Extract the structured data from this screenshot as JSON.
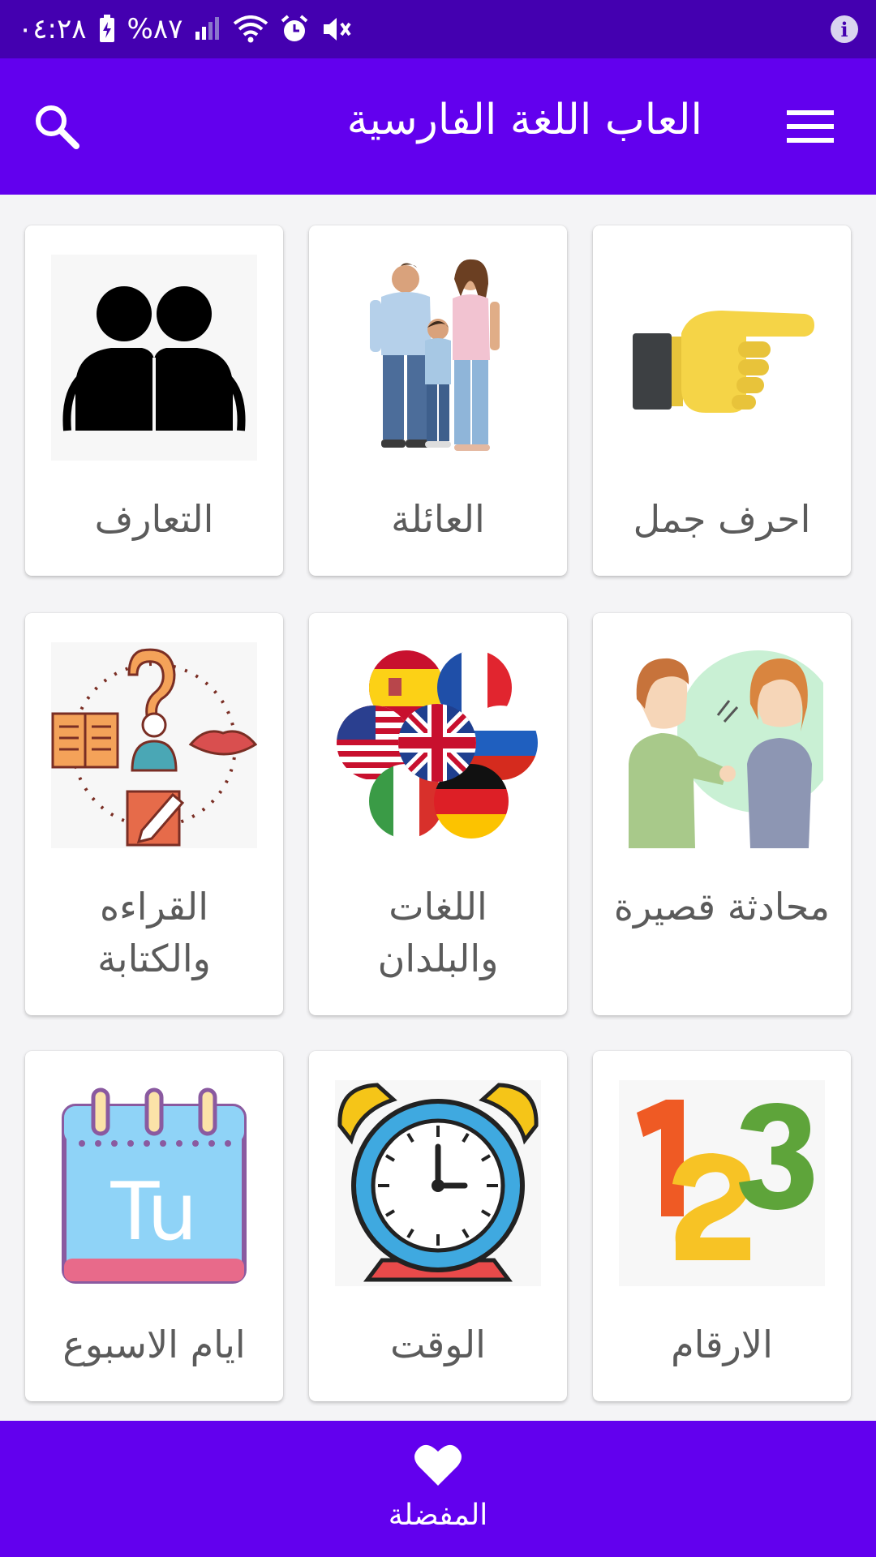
{
  "status_bar": {
    "time": "٠٤:٢٨",
    "battery": "%٨٧",
    "icons": [
      "battery-charging-icon",
      "signal-icon",
      "wifi-icon",
      "alarm-icon",
      "mute-icon",
      "info-icon"
    ]
  },
  "app_bar": {
    "title": "العاب اللغة الفارسية",
    "background": "#6200ee",
    "icons": [
      "search-icon",
      "menu-icon"
    ]
  },
  "categories": [
    {
      "label": "احرف جمل",
      "icon": "pointing-hand-icon"
    },
    {
      "label": "العائلة",
      "icon": "family-photo"
    },
    {
      "label": "التعارف",
      "icon": "two-people-icon"
    },
    {
      "label": "محادثة قصيرة",
      "icon": "conversation-icon"
    },
    {
      "label": "اللغات والبلدان",
      "icon": "flags-icon"
    },
    {
      "label": "القراءه والكتابة",
      "icon": "reading-writing-icon"
    },
    {
      "label": "الارقام",
      "icon": "numbers-123-icon"
    },
    {
      "label": "الوقت",
      "icon": "alarm-clock-icon"
    },
    {
      "label": "ايام الاسبوع",
      "icon": "calendar-tu-icon"
    }
  ],
  "bottom_nav": {
    "favorites_label": "المفضلة",
    "icon": "heart-icon"
  },
  "colors": {
    "status_bar": "#4400b0",
    "primary": "#6200ee",
    "card_text": "#5b5b5b"
  }
}
